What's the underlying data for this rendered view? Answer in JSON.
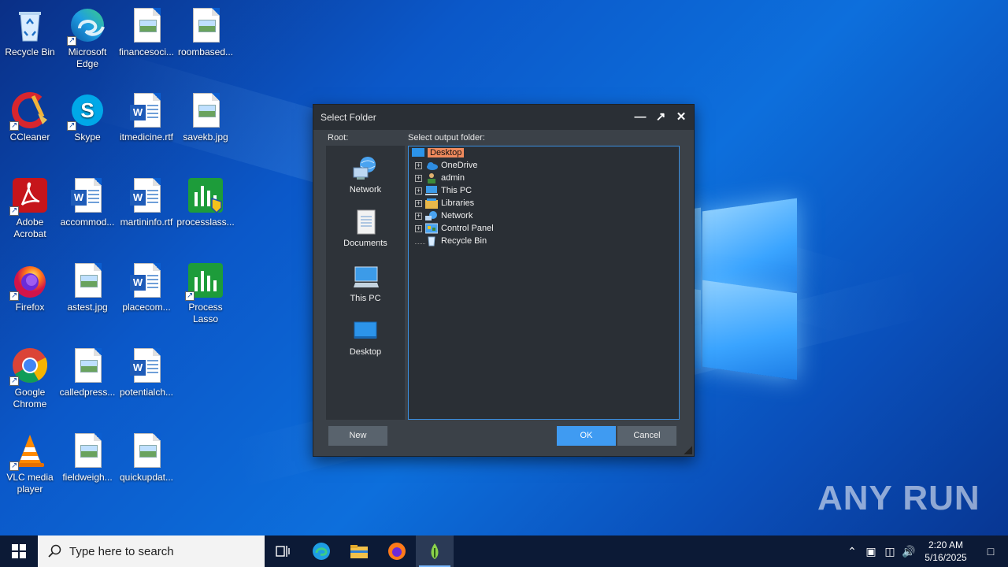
{
  "desktop": {
    "icons": [
      {
        "name": "recycle-bin",
        "label": "Recycle Bin",
        "icon": "recycle-bin-icon"
      },
      {
        "name": "microsoft-edge",
        "label": "Microsoft Edge",
        "icon": "edge-icon"
      },
      {
        "name": "financesoci",
        "label": "financesoci...",
        "icon": "image-file-icon"
      },
      {
        "name": "roombased",
        "label": "roombased...",
        "icon": "image-file-icon"
      },
      {
        "name": "ccleaner",
        "label": "CCleaner",
        "icon": "ccleaner-icon"
      },
      {
        "name": "skype",
        "label": "Skype",
        "icon": "skype-icon"
      },
      {
        "name": "itmedicine",
        "label": "itmedicine.rtf",
        "icon": "word-doc-icon"
      },
      {
        "name": "savekb",
        "label": "savekb.jpg",
        "icon": "image-file-icon"
      },
      {
        "name": "adobe-acrobat",
        "label": "Adobe Acrobat",
        "icon": "acrobat-icon"
      },
      {
        "name": "accommod",
        "label": "accommod...",
        "icon": "word-doc-icon"
      },
      {
        "name": "martininfo",
        "label": "martininfo.rtf",
        "icon": "word-doc-icon"
      },
      {
        "name": "processlass",
        "label": "processlass...",
        "icon": "process-lasso-icon"
      },
      {
        "name": "firefox",
        "label": "Firefox",
        "icon": "firefox-icon"
      },
      {
        "name": "astest",
        "label": "astest.jpg",
        "icon": "image-file-icon"
      },
      {
        "name": "placecom",
        "label": "placecom...",
        "icon": "word-doc-icon"
      },
      {
        "name": "process-lasso",
        "label": "Process Lasso",
        "icon": "process-lasso-icon"
      },
      {
        "name": "google-chrome",
        "label": "Google Chrome",
        "icon": "chrome-icon"
      },
      {
        "name": "calledpress",
        "label": "calledpress...",
        "icon": "image-file-icon"
      },
      {
        "name": "potentialch",
        "label": "potentialch...",
        "icon": "word-doc-icon"
      },
      {
        "name": "vlc",
        "label": "VLC media player",
        "icon": "vlc-icon"
      },
      {
        "name": "fieldweigh",
        "label": "fieldweigh...",
        "icon": "image-file-icon"
      },
      {
        "name": "quickupdat",
        "label": "quickupdat...",
        "icon": "image-file-icon"
      }
    ]
  },
  "dialog": {
    "title": "Select Folder",
    "root_label": "Root:",
    "output_label": "Select output folder:",
    "roots": [
      {
        "label": "Network",
        "icon": "network-icon"
      },
      {
        "label": "Documents",
        "icon": "documents-icon"
      },
      {
        "label": "This PC",
        "icon": "this-pc-icon"
      },
      {
        "label": "Desktop",
        "icon": "desktop-icon"
      }
    ],
    "tree": {
      "root": "Desktop",
      "children": [
        {
          "label": "OneDrive",
          "icon": "onedrive-icon",
          "expandable": true
        },
        {
          "label": "admin",
          "icon": "user-folder-icon",
          "expandable": true
        },
        {
          "label": "This PC",
          "icon": "this-pc-icon",
          "expandable": true
        },
        {
          "label": "Libraries",
          "icon": "libraries-icon",
          "expandable": true
        },
        {
          "label": "Network",
          "icon": "network-icon",
          "expandable": true
        },
        {
          "label": "Control Panel",
          "icon": "control-panel-icon",
          "expandable": true
        },
        {
          "label": "Recycle Bin",
          "icon": "recycle-bin-icon",
          "expandable": false
        }
      ]
    },
    "buttons": {
      "new": "New",
      "ok": "OK",
      "cancel": "Cancel"
    }
  },
  "taskbar": {
    "search_placeholder": "Type here to search",
    "apps": [
      "task-view-icon",
      "edge-icon",
      "file-explorer-icon",
      "firefox-icon",
      "app-active-icon"
    ],
    "clock": {
      "time": "2:20 AM",
      "date": "5/16/2025"
    }
  },
  "watermark": "ANY RUN"
}
